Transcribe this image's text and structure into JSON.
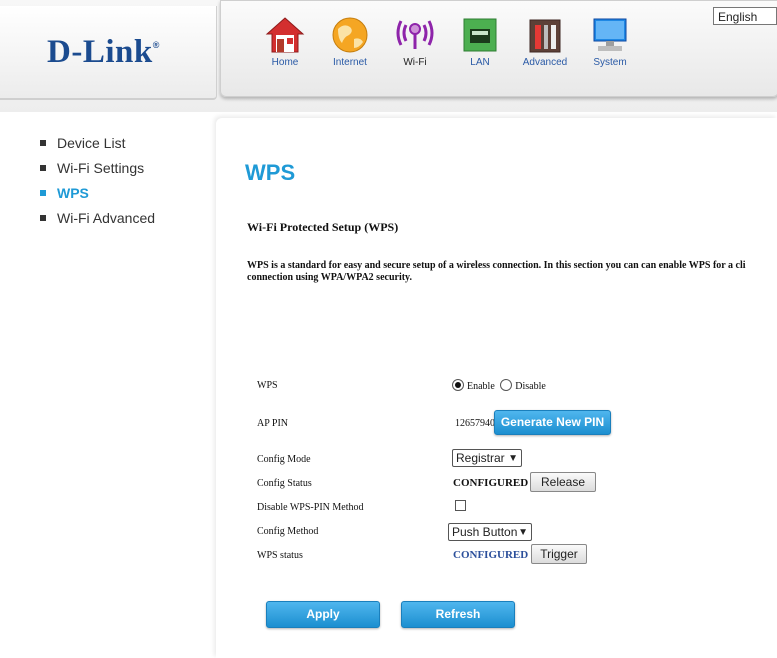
{
  "header": {
    "logo": "D-Link",
    "logo_mark": "®",
    "language": "English",
    "nav": [
      {
        "label": "Home",
        "icon": "home-icon"
      },
      {
        "label": "Internet",
        "icon": "globe-icon"
      },
      {
        "label": "Wi-Fi",
        "icon": "wifi-icon"
      },
      {
        "label": "LAN",
        "icon": "lan-icon"
      },
      {
        "label": "Advanced",
        "icon": "tools-icon"
      },
      {
        "label": "System",
        "icon": "monitor-icon"
      }
    ]
  },
  "sidebar": {
    "items": [
      {
        "label": "Device List"
      },
      {
        "label": "Wi-Fi Settings"
      },
      {
        "label": "WPS"
      },
      {
        "label": "Wi-Fi Advanced"
      }
    ]
  },
  "main": {
    "title": "WPS",
    "section_title": "Wi-Fi Protected Setup (WPS)",
    "description_line1": "WPS is a standard for easy and secure setup of a wireless connection. In this section you can can enable WPS for a cli",
    "description_line2": "connection using WPA/WPA2 security.",
    "fields": {
      "wps_label": "WPS",
      "wps_enable": "Enable",
      "wps_disable": "Disable",
      "ap_pin_label": "AP PIN",
      "ap_pin_value": "12657940",
      "generate_pin": "Generate New PIN",
      "config_mode_label": "Config Mode",
      "config_mode_value": "Registrar",
      "config_status_label": "Config Status",
      "config_status_value": "CONFIGURED",
      "release": "Release",
      "disable_pin_label": "Disable WPS-PIN Method",
      "config_method_label": "Config Method",
      "config_method_value": "Push Button",
      "wps_status_label": "WPS status",
      "wps_status_value": "CONFIGURED",
      "trigger": "Trigger"
    },
    "apply": "Apply",
    "refresh": "Refresh"
  },
  "colors": {
    "accent": "#1f9ad6",
    "brand": "#1b4b8f",
    "status_blue": "#2b4f9b"
  }
}
